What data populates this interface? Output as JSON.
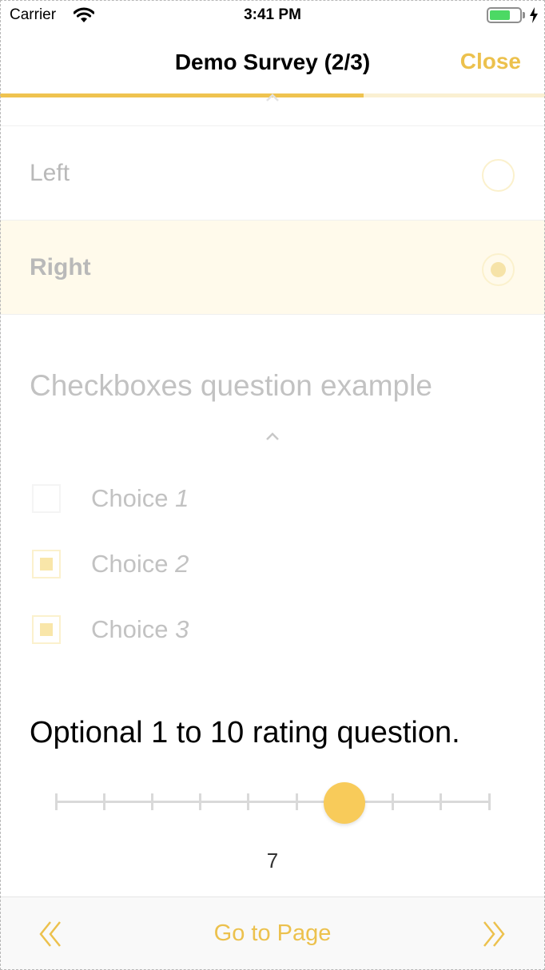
{
  "status_bar": {
    "carrier": "Carrier",
    "time": "3:41 PM",
    "battery_level": 0.7
  },
  "nav": {
    "title": "Demo Survey (2/3)",
    "close_label": "Close",
    "progress": 0.667
  },
  "radio_question": {
    "options": [
      {
        "label": "Left",
        "selected": false
      },
      {
        "label": "Right",
        "selected": true
      }
    ]
  },
  "checkbox_question": {
    "title": "Checkboxes question example",
    "choices": [
      {
        "label": "Choice",
        "number": "1",
        "checked": false
      },
      {
        "label": "Choice",
        "number": "2",
        "checked": true
      },
      {
        "label": "Choice",
        "number": "3",
        "checked": true
      }
    ]
  },
  "rating_question": {
    "title": "Optional 1 to 10 rating question.",
    "min": 1,
    "max": 10,
    "value": 7,
    "value_label": "7"
  },
  "toolbar": {
    "go_to_page_label": "Go to Page"
  },
  "colors": {
    "accent": "#ecc14d",
    "thumb": "#f8cb5a",
    "selected_row": "#fffaeb",
    "muted_text": "#c2c2c2"
  },
  "icons": [
    "wifi-icon",
    "battery-icon",
    "charging-bolt-icon",
    "chevron-up-icon",
    "double-chevron-left-icon",
    "double-chevron-right-icon"
  ]
}
